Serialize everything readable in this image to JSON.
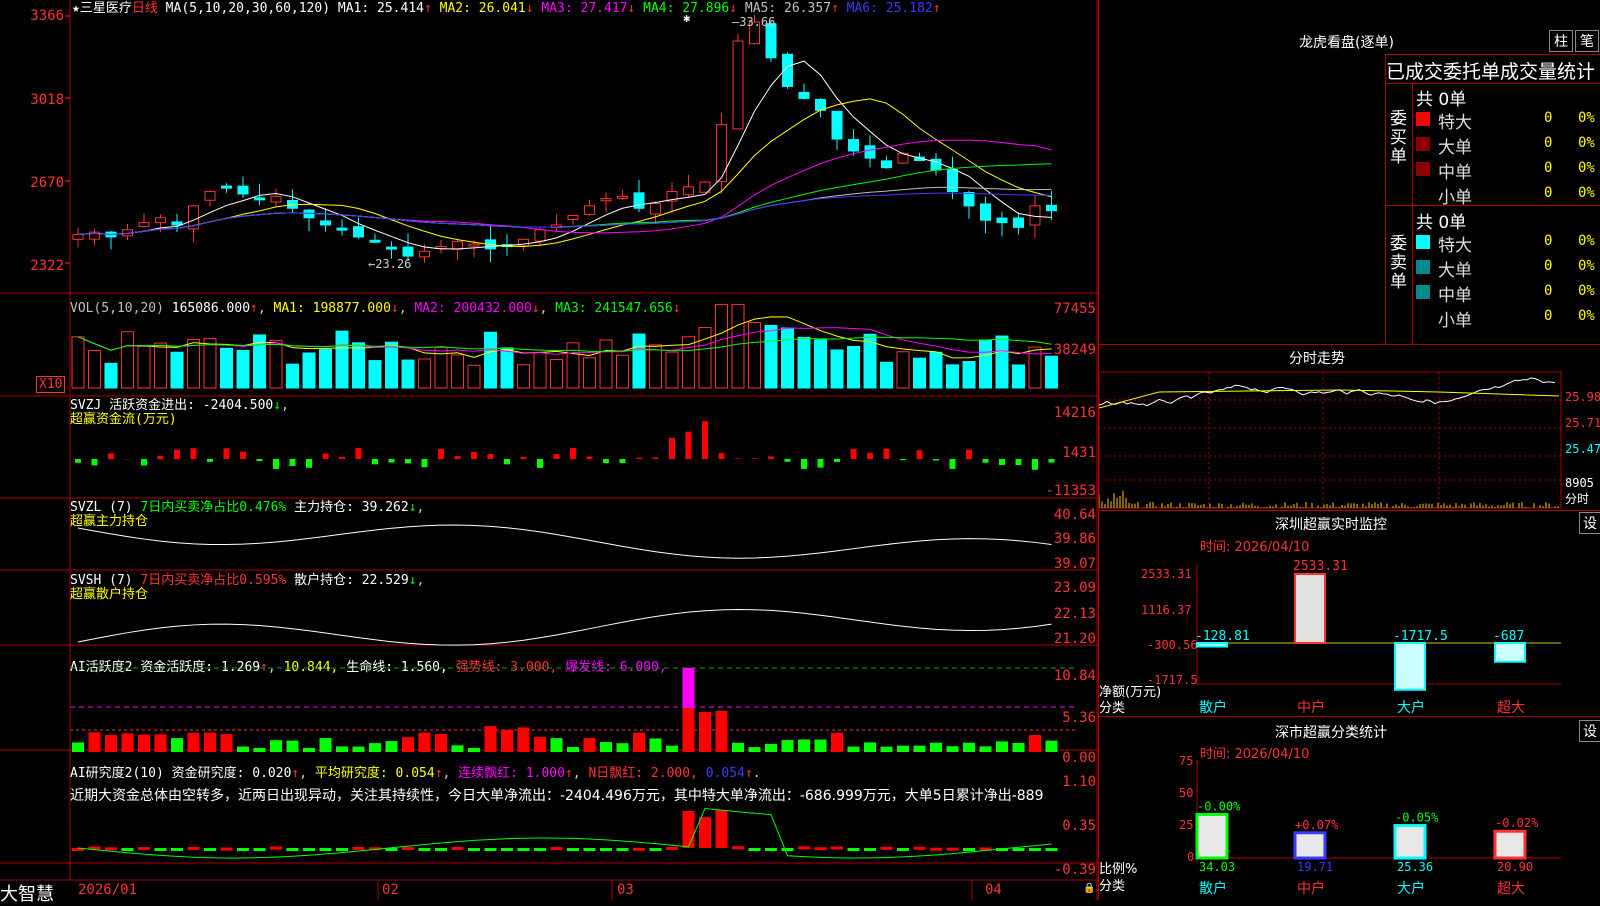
{
  "main": {
    "stock_name": "★三星医疗",
    "period": "日线",
    "ma_header": "MA(5,10,20,30,60,120)",
    "ma": [
      {
        "label": "MA1:",
        "value": "25.414",
        "arrow": "↑",
        "color": "#ffffff"
      },
      {
        "label": "MA2:",
        "value": "26.041",
        "arrow": "↓",
        "color": "#ffff00"
      },
      {
        "label": "MA3:",
        "value": "27.417",
        "arrow": "↓",
        "color": "#ff00ff"
      },
      {
        "label": "MA4:",
        "value": "27.896",
        "arrow": "↓",
        "color": "#00ff00"
      },
      {
        "label": "MA5:",
        "value": "26.357",
        "arrow": "↑",
        "color": "#c0c0c0"
      },
      {
        "label": "MA6:",
        "value": "25.182",
        "arrow": "↑",
        "color": "#3b3bff"
      }
    ],
    "y_labels": [
      "3366",
      "3018",
      "2670",
      "2322"
    ],
    "high_label": "33.66",
    "low_label": "23.26"
  },
  "vol": {
    "header": "VOL(5,10,20)",
    "value": "165086.000",
    "ma1": "MA1: 198877.000",
    "ma2": "MA2: 200432.000",
    "ma3": "MA3: 241547.656",
    "y_labels": [
      "77455",
      "38249"
    ],
    "unit": "X10"
  },
  "svzj": {
    "header": "SVZJ  活跃资金进出: -2404.500",
    "sub": "超赢资金流(万元)",
    "y_labels": [
      "14216",
      "1431",
      "-11353"
    ]
  },
  "svzl": {
    "header": "SVZL (7)",
    "tag": "7日内买卖净占比0.476%",
    "value": "主力持仓: 39.262",
    "sub": "超赢主力持仓",
    "y_labels": [
      "40.64",
      "39.86",
      "39.07"
    ]
  },
  "svsh": {
    "header": "SVSH (7)",
    "tag": "7日内买卖净占比0.595%",
    "value": "散户持仓: 22.529",
    "sub": "超赢散户持仓",
    "y_labels": [
      "23.09",
      "22.13",
      "21.20"
    ]
  },
  "ai1": {
    "header": "AI活跃度2 资金活跃度: 1.269",
    "v2": "10.844,",
    "v3": "生命线: 1.560,",
    "v4": "强势线: 3.000,",
    "v5": "爆发线: 6.000,",
    "y_labels": [
      "10.84",
      "5.36",
      "0.00"
    ]
  },
  "ai2": {
    "header": "AI研究度2(10) 资金研究度: 0.020",
    "v2": "平均研究度: 0.054",
    "v3": "连续飘红: 1.000",
    "v4": "N日飘红: 2.000,",
    "v5": "0.054",
    "comment": "近期大资金总体由空转多，近两日出现异动，关注其持续性，今日大单净流出：-2404.496万元，其中特大单净流出：-686.999万元，大单5日累计净出-889",
    "y_labels": [
      "1.10",
      "0.35",
      "-0.39"
    ]
  },
  "xaxis": {
    "logo": "大智慧",
    "dates": [
      "2026/01",
      "02",
      "03",
      "04"
    ]
  },
  "right": {
    "title": "龙虎看盘(逐单)",
    "btn1": "柱",
    "btn2": "笔",
    "stat_title": "已成交委托单成交量统计",
    "buy_label": "委买单",
    "sell_label": "委卖单",
    "buy_total": "共 0单",
    "sell_total": "共 0单",
    "buy_rows": [
      {
        "name": "特大",
        "count": "0",
        "pct": "0%",
        "color": "#ff0000"
      },
      {
        "name": "大单",
        "count": "0",
        "pct": "0%",
        "color": "#8b0000"
      },
      {
        "name": "中单",
        "count": "0",
        "pct": "0%",
        "color": "#8b0000"
      },
      {
        "name": "小单",
        "count": "0",
        "pct": "0%",
        "color": "#000000"
      }
    ],
    "sell_rows": [
      {
        "name": "特大",
        "count": "0",
        "pct": "0%",
        "color": "#00ffff"
      },
      {
        "name": "大单",
        "count": "0",
        "pct": "0%",
        "color": "#008b8b"
      },
      {
        "name": "中单",
        "count": "0",
        "pct": "0%",
        "color": "#008b8b"
      },
      {
        "name": "小单",
        "count": "0",
        "pct": "0%",
        "color": "#000000"
      }
    ],
    "intraday_title": "分时走势",
    "intraday_labels": [
      "25.98",
      "25.71",
      "25.47",
      "8905",
      "分时"
    ],
    "monitor_title": "深圳超赢实时监控",
    "set_btn": "设",
    "monitor_time": "时间: 2026/04/10",
    "monitor_y": [
      "2533.31",
      "1116.37",
      "-300.56",
      "-1717.5"
    ],
    "monitor_ylabel": "净额(万元)",
    "monitor_xlabel": "分类",
    "monitor_cats": [
      "散户",
      "中户",
      "大户",
      "超大"
    ],
    "monitor_values": [
      -128.81,
      2533.31,
      -1717.5,
      -687
    ],
    "monitor_value_labels": [
      "-128.81",
      "2533.31",
      "-1717.5",
      "-687"
    ],
    "class_title": "深市超赢分类统计",
    "class_time": "时间: 2026/04/10",
    "class_y": [
      "75",
      "50",
      "25",
      "0"
    ],
    "class_ylabel": "比例%",
    "class_xlabel": "分类",
    "class_cats": [
      "散户",
      "中户",
      "大户",
      "超大"
    ],
    "class_values": [
      34.03,
      19.71,
      25.36,
      20.9
    ],
    "class_value_labels": [
      "34.03",
      "19.71",
      "25.36",
      "20.90"
    ],
    "class_change_labels": [
      "-0.00%",
      "+0.07%",
      "-0.05%",
      "-0.02%"
    ]
  },
  "colors": {
    "up": "#ff3232",
    "down": "#00ffff",
    "grid": "#b00000"
  }
}
